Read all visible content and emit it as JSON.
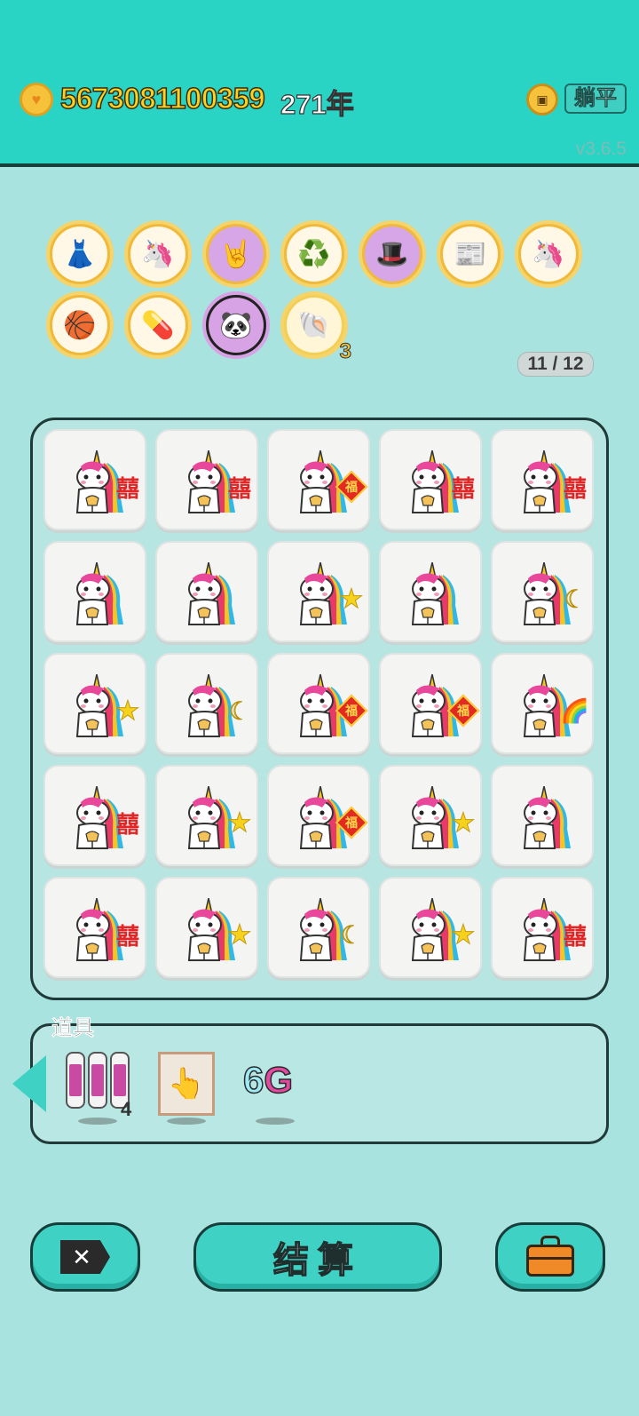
{
  "header": {
    "coins_icon": "heart-coin-icon",
    "score": "5673081100359",
    "years": "271年",
    "lie_flat_button": "躺平",
    "version": "v3.6.5"
  },
  "badges": [
    {
      "name": "skirt-badge",
      "icon": "👗"
    },
    {
      "name": "unicorn-badge",
      "icon": "🦄"
    },
    {
      "name": "rock-hand-badge",
      "icon": "🤘"
    },
    {
      "name": "recycle-badge",
      "icon": "♻️"
    },
    {
      "name": "green-hat-badge",
      "icon": "🎩"
    },
    {
      "name": "time-magazine-badge",
      "icon": "📰"
    },
    {
      "name": "unicorn-gold-badge",
      "icon": "🦄"
    },
    {
      "name": "basketballs-badge",
      "icon": "🏀"
    },
    {
      "name": "capsule-badge",
      "icon": "💊"
    },
    {
      "name": "panda-badge",
      "icon": "🐼"
    },
    {
      "name": "shell-badge",
      "icon": "🐚",
      "count": "3"
    }
  ],
  "progress": "11 / 12",
  "grid": [
    [
      "xi",
      "xi",
      "fu",
      "xi",
      "xi"
    ],
    [
      "none",
      "none",
      "star",
      "none",
      "moon"
    ],
    [
      "star",
      "moon",
      "fu",
      "fu",
      "rainbow"
    ],
    [
      "xi",
      "star",
      "fu",
      "star",
      "none"
    ],
    [
      "xi",
      "star",
      "moon",
      "star",
      "xi"
    ]
  ],
  "ornament_glyphs": {
    "xi": "囍",
    "fu": "福",
    "star": "★",
    "moon": "☾",
    "rainbow": "🌈"
  },
  "tray": {
    "title": "道具",
    "slots_count": "4",
    "hand_icon": "👆",
    "six": "6",
    "g": "G"
  },
  "buttons": {
    "close": "✕",
    "settle": "结算",
    "bag": "briefcase-icon"
  }
}
